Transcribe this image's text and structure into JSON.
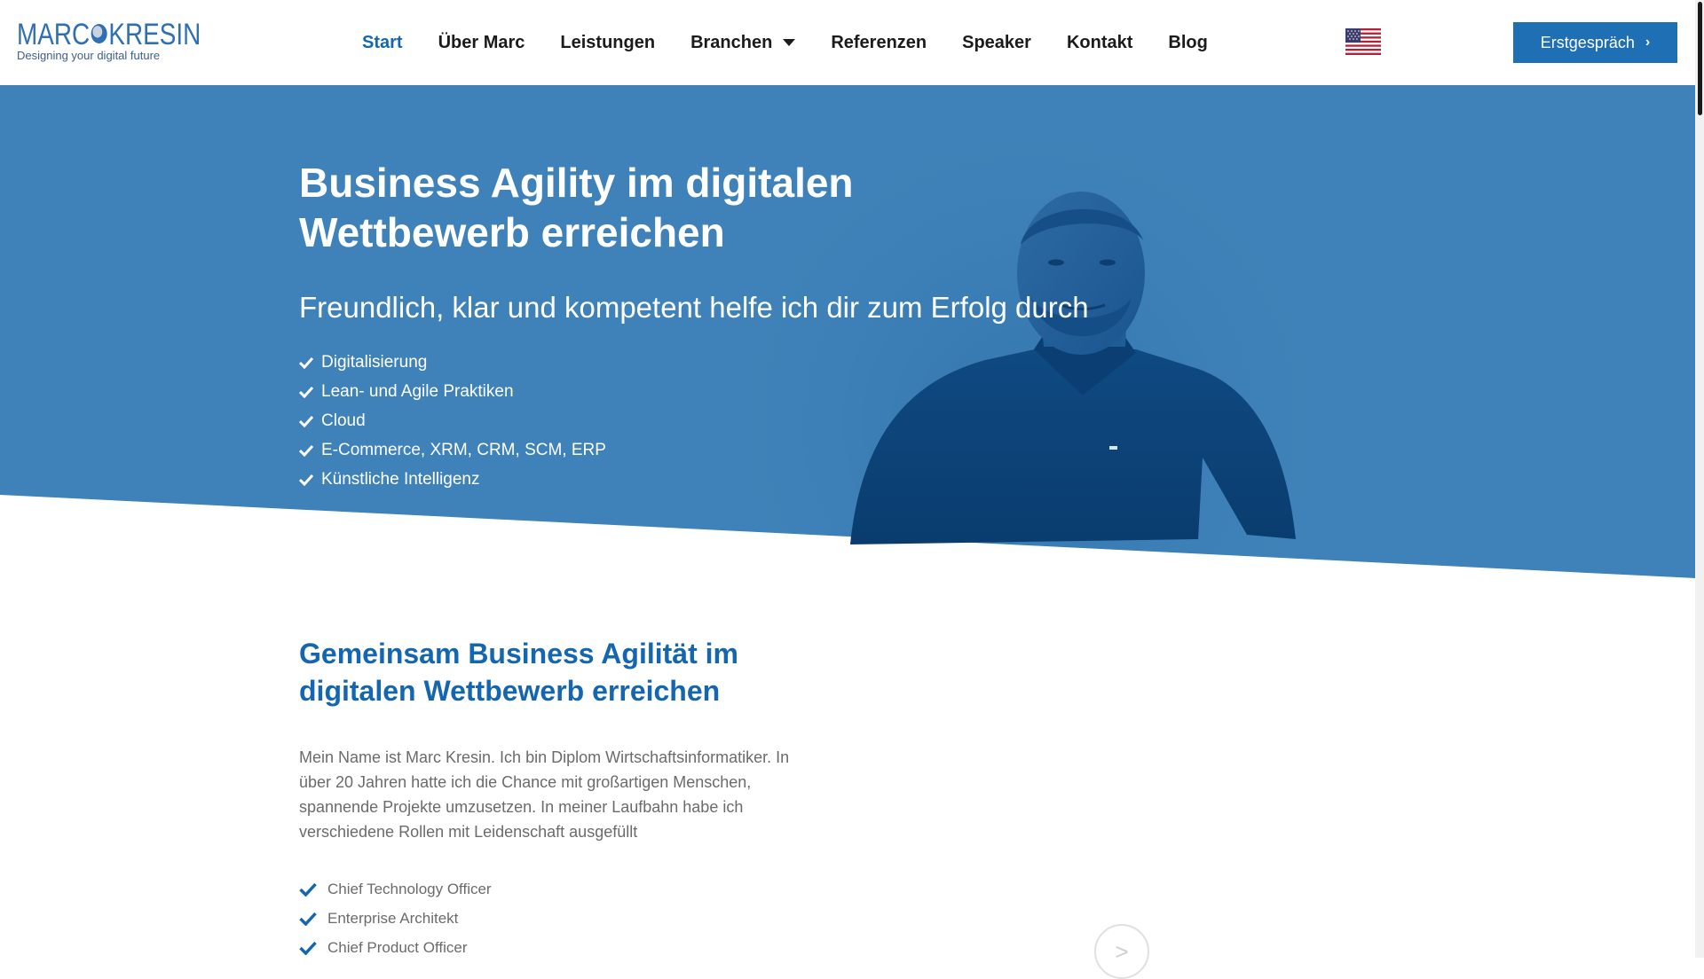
{
  "brand": {
    "logo_main": "MARC KRESIN",
    "logo_main_left": "MARC",
    "logo_main_right": "KRESIN",
    "tagline": "Designing your digital future"
  },
  "nav": {
    "items": [
      {
        "label": "Start",
        "active": true
      },
      {
        "label": "Über Marc"
      },
      {
        "label": "Leistungen"
      },
      {
        "label": "Branchen",
        "dropdown": true
      },
      {
        "label": "Referenzen"
      },
      {
        "label": "Speaker"
      },
      {
        "label": "Kontakt"
      },
      {
        "label": "Blog"
      }
    ],
    "language_icon": "us-flag-icon",
    "cta_label": "Erstgespräch",
    "cta_icon": "chevron-right-icon"
  },
  "hero": {
    "title": "Business Agility im digitalen Wettbewerb erreichen",
    "subtitle": "Freundlich, klar und kompetent helfe ich dir zum Erfolg durch",
    "items": [
      "Digitalisierung",
      "Lean- und Agile Praktiken",
      "Cloud",
      "E-Commerce, XRM, CRM, SCM, ERP",
      "Künstliche Intelligenz"
    ]
  },
  "about": {
    "title": "Gemeinsam Business Agilität im digitalen Wettbewerb erreichen",
    "text": "Mein Name ist Marc Kresin. Ich bin Diplom Wirtschaftsinformatiker. In über 20 Jahren hatte ich die Chance mit großartigen Menschen, spannende Projekte umzusetzen. In meiner Laufbahn habe ich verschiedene Rollen mit Leidenschaft ausgefüllt",
    "roles": [
      "Chief Technology Officer",
      "Enterprise Architekt",
      "Chief Product Officer"
    ],
    "video_icon": "play-icon",
    "play_glyph": ">"
  },
  "colors": {
    "hero_blue": "#3e82b9",
    "accent": "#1566b0",
    "cta": "#1f6fb5"
  }
}
